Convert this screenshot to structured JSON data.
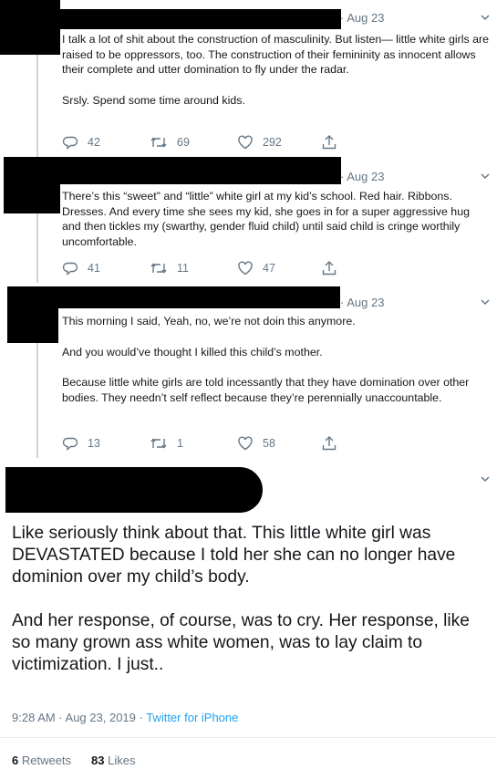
{
  "tweets": [
    {
      "date": "· Aug 23",
      "paragraphs": [
        "I talk a lot of shit about the construction of masculinity. But listen— little white girls are raised to be oppressors, too. The construction of their femininity as innocent allows their complete and utter domination to fly under the radar.",
        "Srsly. Spend some time around kids."
      ],
      "replies": "42",
      "retweets": "69",
      "likes": "292"
    },
    {
      "date": "· Aug 23",
      "paragraphs": [
        "There’s this “sweet” and “little” white girl at my kid’s school. Red hair. Ribbons. Dresses. And every time she sees my kid, she goes in for a super aggressive hug and then tickles my (swarthy, gender fluid child) until said child is cringe worthily uncomfortable."
      ],
      "replies": "41",
      "retweets": "11",
      "likes": "47"
    },
    {
      "date": "· Aug 23",
      "paragraphs": [
        "This morning I said, Yeah, no, we’re not doin this anymore.",
        "And you would’ve thought I killed this child’s mother.",
        "Because little white girls are told incessantly that they have domination over other bodies. They needn’t self reflect because they’re perennially unaccountable."
      ],
      "replies": "13",
      "retweets": "1",
      "likes": "58"
    }
  ],
  "main_tweet": {
    "paragraphs": [
      "Like seriously think about that. This little white girl was DEVASTATED because I told her she can no longer have dominion over my child’s body.",
      "And her response, of course, was to cry. Her response, like so many grown ass white women, was to lay claim to victimization. I just.."
    ],
    "time": "9:28 AM · Aug 23, 2019 · ",
    "source": "Twitter for iPhone",
    "retweets_count": "6",
    "retweets_label": " Retweets",
    "likes_count": "83",
    "likes_label": " Likes"
  },
  "icons": {
    "reply": "reply-icon",
    "retweet": "retweet-icon",
    "like": "heart-icon",
    "share": "share-icon",
    "caret": "chevron-down-icon"
  },
  "colors": {
    "text": "#14171a",
    "secondary": "#657786",
    "link": "#1da1f2",
    "thread_line": "#ccd6dd",
    "redaction": "#000000"
  }
}
